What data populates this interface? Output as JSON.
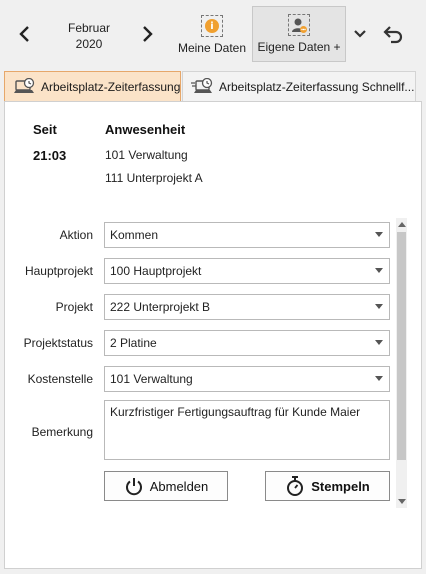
{
  "toolbar": {
    "month": "Februar",
    "year": "2020",
    "meine_daten_label": "Meine Daten",
    "eigene_daten_label": "Eigene Daten +"
  },
  "tabs": [
    {
      "label": "Arbeitsplatz-Zeiterfassung"
    },
    {
      "label": "Arbeitsplatz-Zeiterfassung Schnellf..."
    }
  ],
  "status": {
    "seit_label": "Seit",
    "seit_value": "21:03",
    "anwesenheit_label": "Anwesenheit",
    "anwesenheit_lines": [
      "101 Verwaltung",
      "111 Unterprojekt A"
    ]
  },
  "form": {
    "fields": [
      {
        "label": "Aktion",
        "value": "Kommen"
      },
      {
        "label": "Hauptprojekt",
        "value": "100 Hauptprojekt"
      },
      {
        "label": "Projekt",
        "value": "222 Unterprojekt B"
      },
      {
        "label": "Projektstatus",
        "value": "2 Platine"
      },
      {
        "label": "Kostenstelle",
        "value": "101 Verwaltung"
      }
    ],
    "bemerkung_label": "Bemerkung",
    "bemerkung_value": "Kurzfristiger Fertigungsauftrag für Kunde Maier"
  },
  "buttons": {
    "abmelden": "Abmelden",
    "stempeln": "Stempeln"
  },
  "colors": {
    "tab_active_bg": "#fbe3c8",
    "tab_active_border": "#e6a76a",
    "accent_orange": "#f0a030"
  }
}
